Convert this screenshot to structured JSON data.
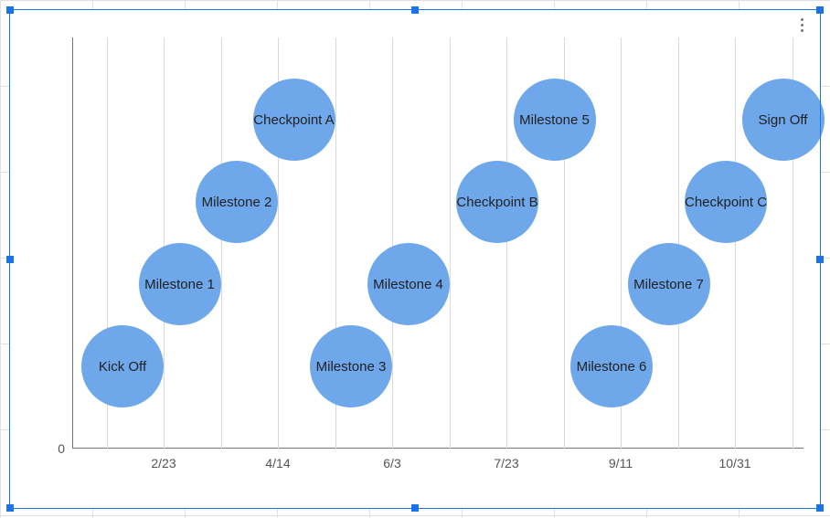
{
  "colors": {
    "bubble_fill": "#6fa8ea",
    "selection": "#1a73e8",
    "axis": "#757575",
    "grid": "#d9d9d9",
    "text": "#202124"
  },
  "y_zero_label": "0",
  "chart_data": {
    "type": "scatter",
    "title": "",
    "xlabel": "",
    "ylabel": "",
    "x_type": "date",
    "x_range_days": [
      0,
      320
    ],
    "ylim": [
      0,
      5
    ],
    "x_ticks": [
      {
        "label": "2/23",
        "day": 40
      },
      {
        "label": "4/14",
        "day": 90
      },
      {
        "label": "6/3",
        "day": 140
      },
      {
        "label": "7/23",
        "day": 190
      },
      {
        "label": "9/11",
        "day": 240
      },
      {
        "label": "10/31",
        "day": 290
      }
    ],
    "grid_days": [
      15,
      40,
      65,
      90,
      115,
      140,
      165,
      190,
      215,
      240,
      265,
      290,
      315
    ],
    "bubble_size": 3,
    "points": [
      {
        "label": "Kick Off",
        "day": 22,
        "y": 1
      },
      {
        "label": "Milestone 1",
        "day": 47,
        "y": 2
      },
      {
        "label": "Milestone 2",
        "day": 72,
        "y": 3
      },
      {
        "label": "Checkpoint A",
        "day": 97,
        "y": 4
      },
      {
        "label": "Milestone 3",
        "day": 122,
        "y": 1
      },
      {
        "label": "Milestone 4",
        "day": 147,
        "y": 2
      },
      {
        "label": "Checkpoint B",
        "day": 186,
        "y": 3
      },
      {
        "label": "Milestone 5",
        "day": 211,
        "y": 4
      },
      {
        "label": "Milestone 6",
        "day": 236,
        "y": 1
      },
      {
        "label": "Milestone 7",
        "day": 261,
        "y": 2
      },
      {
        "label": "Checkpoint C",
        "day": 286,
        "y": 3
      },
      {
        "label": "Sign Off",
        "day": 311,
        "y": 4
      }
    ]
  }
}
